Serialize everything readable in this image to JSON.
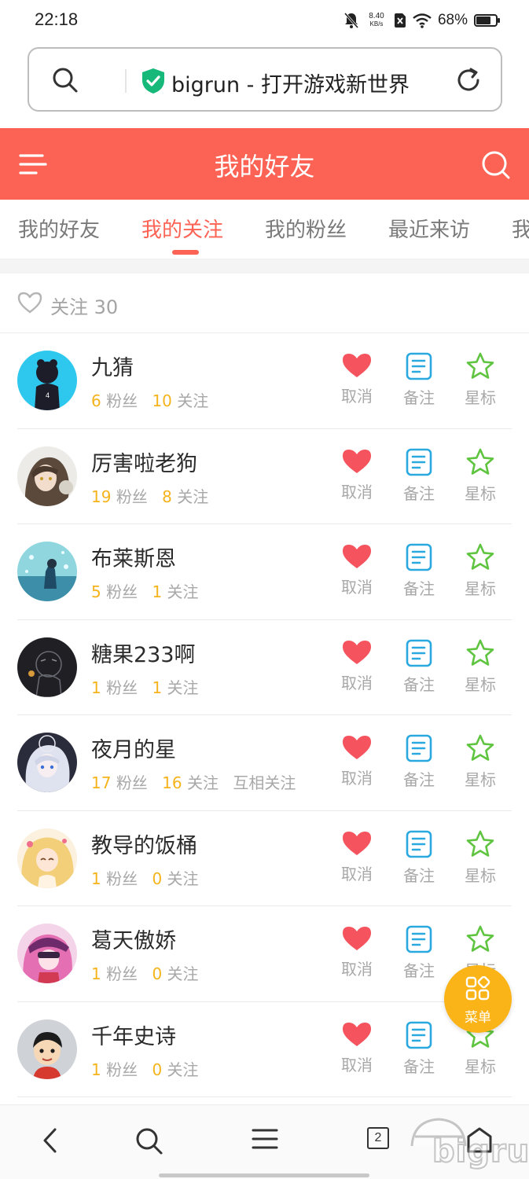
{
  "status_bar": {
    "time": "22:18",
    "net_speed_value": "8.40",
    "net_speed_unit": "KB/s",
    "battery_text": "68%",
    "battery_level": 0.68,
    "icons": [
      "bell-off-icon",
      "sim-off-icon",
      "wifi-icon",
      "battery-icon"
    ]
  },
  "address_bar": {
    "text": "bigrun - 打开游戏新世界",
    "icons": [
      "search-icon",
      "shield-check-icon",
      "refresh-icon"
    ]
  },
  "header": {
    "title": "我的好友",
    "background": "#fd6354",
    "icons": [
      "menu-icon",
      "search-icon"
    ]
  },
  "tabs": [
    {
      "label": "我的好友",
      "active": false
    },
    {
      "label": "我的关注",
      "active": true
    },
    {
      "label": "我的粉丝",
      "active": false
    },
    {
      "label": "最近来访",
      "active": false
    },
    {
      "label": "我",
      "active": false
    }
  ],
  "follow_summary": {
    "label": "关注 30",
    "icon": "heart-outline-icon"
  },
  "labels": {
    "fans": "粉丝",
    "following": "关注",
    "cancel": "取消",
    "note": "备注",
    "star": "星标"
  },
  "friends": [
    {
      "name": "九猜",
      "fans": "6",
      "following": "10",
      "mutual": ""
    },
    {
      "name": "厉害啦老狗",
      "fans": "19",
      "following": "8",
      "mutual": ""
    },
    {
      "name": "布莱斯恩",
      "fans": "5",
      "following": "1",
      "mutual": ""
    },
    {
      "name": "糖果233啊",
      "fans": "1",
      "following": "1",
      "mutual": ""
    },
    {
      "name": "夜月的星",
      "fans": "17",
      "following": "16",
      "mutual": "互相关注"
    },
    {
      "name": "教导的饭桶",
      "fans": "1",
      "following": "0",
      "mutual": ""
    },
    {
      "name": "葛天傲娇",
      "fans": "1",
      "following": "0",
      "mutual": ""
    },
    {
      "name": "千年史诗",
      "fans": "1",
      "following": "0",
      "mutual": ""
    }
  ],
  "fab": {
    "label": "菜单",
    "icon": "grid-icon",
    "color": "#fbb418"
  },
  "bottom_nav": {
    "tab_count": "2",
    "icons": [
      "back-icon",
      "search-icon",
      "menu-icon",
      "tabs-icon",
      "home-icon"
    ]
  },
  "watermark": {
    "text": "bigrun"
  },
  "colors": {
    "accent": "#fd6354",
    "number": "#f5b31c",
    "heart": "#f5535d",
    "note": "#2aa8e0",
    "star": "#5fc43f"
  }
}
